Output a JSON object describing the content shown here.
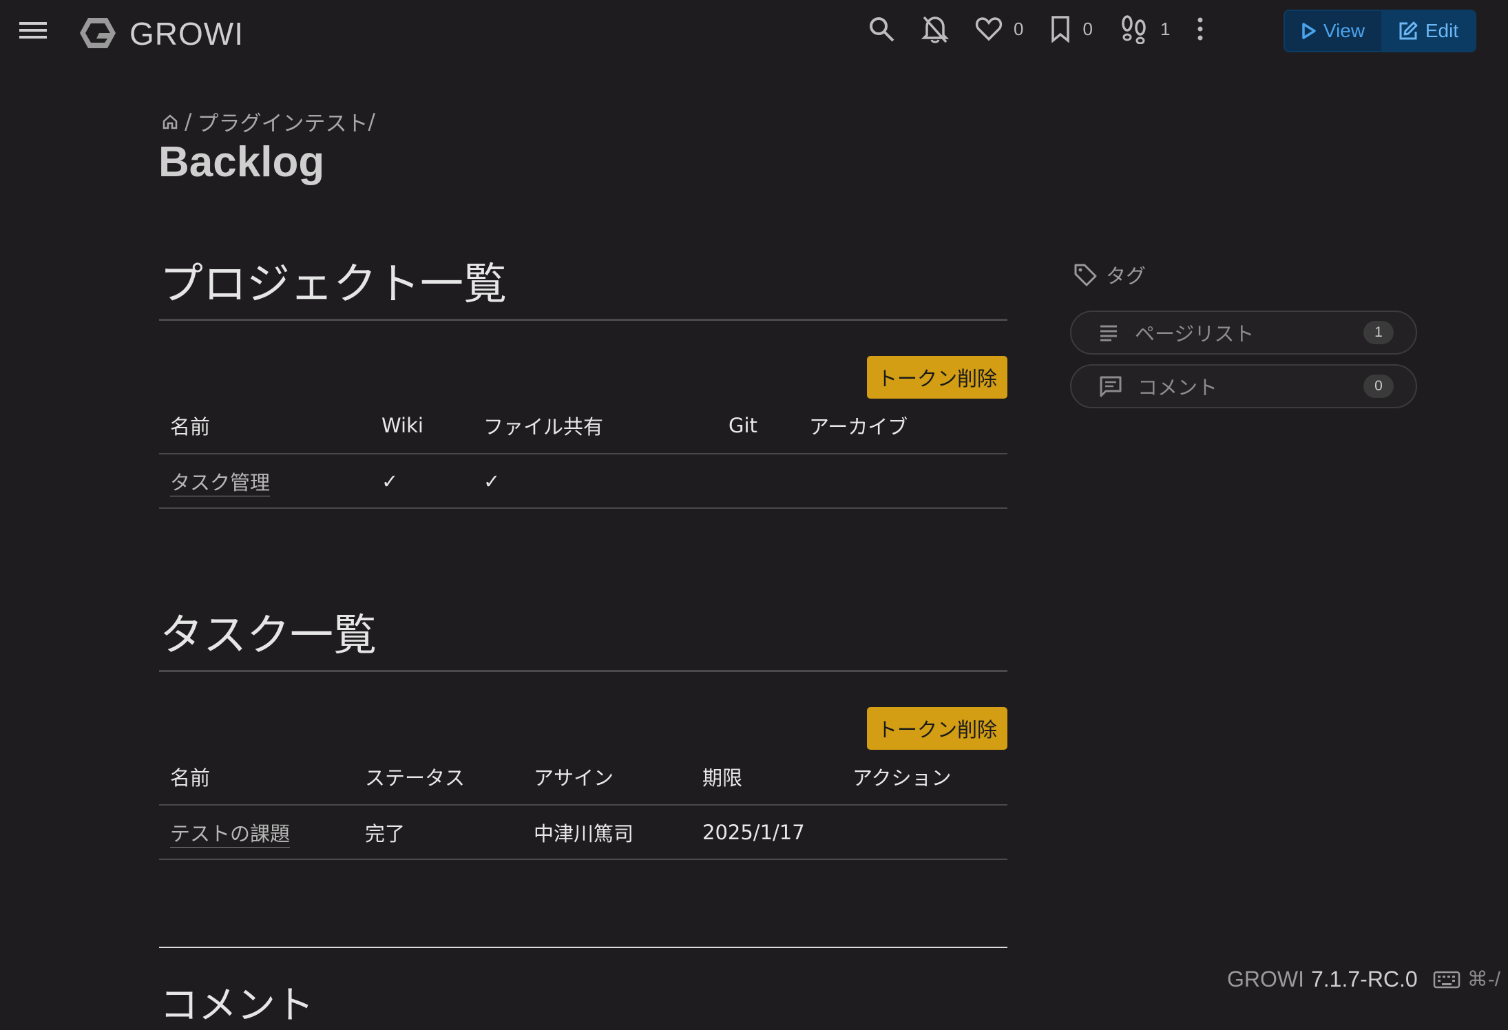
{
  "app": {
    "name": "GROWI",
    "version_prefix": "GROWI",
    "version": "7.1.7-RC.0",
    "shortcut_hint": "⌘-/"
  },
  "navbar": {
    "likes_count": "0",
    "bookmarks_count": "0",
    "seen_count": "1",
    "view_label": "View",
    "edit_label": "Edit"
  },
  "breadcrumb": {
    "separator": "/",
    "parent": "プラグインテスト",
    "trailing_sep": "/"
  },
  "page": {
    "title": "Backlog"
  },
  "projects": {
    "heading": "プロジェクト一覧",
    "token_button": "トークン削除",
    "columns": [
      "名前",
      "Wiki",
      "ファイル共有",
      "Git",
      "アーカイブ"
    ],
    "rows": [
      {
        "name": "タスク管理",
        "wiki": "✓",
        "file_share": "✓",
        "git": "",
        "archive": ""
      }
    ]
  },
  "tasks": {
    "heading": "タスク一覧",
    "token_button": "トークン削除",
    "columns": [
      "名前",
      "ステータス",
      "アサイン",
      "期限",
      "アクション"
    ],
    "rows": [
      {
        "name": "テストの課題",
        "status": "完了",
        "assignee": "中津川篤司",
        "due": "2025/1/17",
        "action": ""
      }
    ]
  },
  "comments_heading": "コメント",
  "sidebar": {
    "tag_label": "タグ",
    "pagelist_label": "ページリスト",
    "pagelist_count": "1",
    "comment_label": "コメント",
    "comment_count": "0"
  },
  "colors": {
    "background": "#1e1c1e",
    "accent_button": "#d39e14",
    "view_blue": "#4ba3ec"
  }
}
